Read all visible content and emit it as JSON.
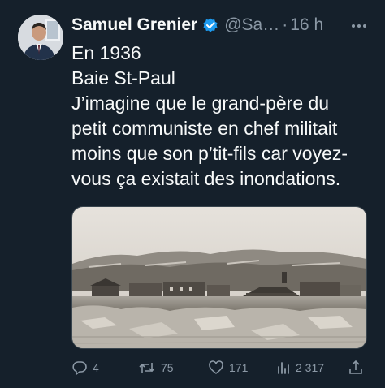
{
  "author": {
    "display_name": "Samuel Grenier",
    "handle": "@Sa…",
    "separator": "·",
    "time": "16 h"
  },
  "tweet": {
    "lines": [
      "En 1936",
      "Baie St-Paul",
      "J’imagine que le grand-père du",
      "petit communiste en chef militait",
      "moins que son p’tit-fils car voyez-",
      "vous ça existait des inondations."
    ]
  },
  "actions": {
    "replies": "4",
    "reposts": "75",
    "likes": "171",
    "views": "2 317"
  },
  "colors": {
    "background": "#15202b",
    "text_primary": "#f7f9f9",
    "text_secondary": "#8b98a5",
    "verified": "#1d9bf0"
  },
  "icons": {
    "verified": "verified-badge-icon",
    "more": "more-dots-icon",
    "reply": "reply-icon",
    "repost": "repost-icon",
    "like": "heart-icon",
    "views": "views-chart-icon",
    "share": "share-icon"
  }
}
